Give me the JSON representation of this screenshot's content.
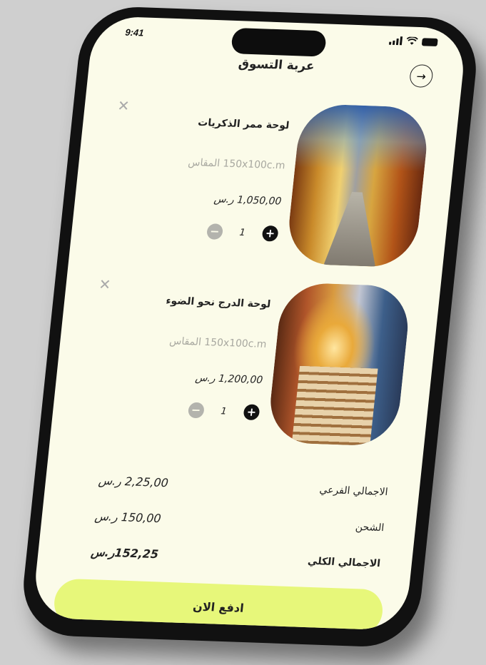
{
  "status": {
    "time": "9:41"
  },
  "header": {
    "title": "عربة التسوق",
    "back_icon": "arrow-right-icon"
  },
  "items": [
    {
      "name": "لوحة ممر الذكريات",
      "size": "150x100c.m المقاس",
      "price": "1,050,00 ر.س",
      "quantity": "1",
      "image": "painting-old-market-street"
    },
    {
      "name": "لوحة الدرج نحو الضوء",
      "size": "150x100c.m المقاس",
      "price": "1,200,00 ر.س",
      "quantity": "1",
      "image": "painting-stone-staircase"
    }
  ],
  "summary": {
    "subtotal_label": "الاجمالي الفرعي",
    "subtotal_value": "2,25,00 ر.س",
    "shipping_label": "الشحن",
    "shipping_value": "150,00 ر.س",
    "total_label": "الاجمالي الكلي",
    "total_value": "152,25ر.س"
  },
  "pay_button": {
    "label": "ادفع الان"
  },
  "colors": {
    "screen_bg": "#fbfbe9",
    "accent": "#e7f77a",
    "device": "#111111",
    "page_bg": "#cfcfcf"
  }
}
